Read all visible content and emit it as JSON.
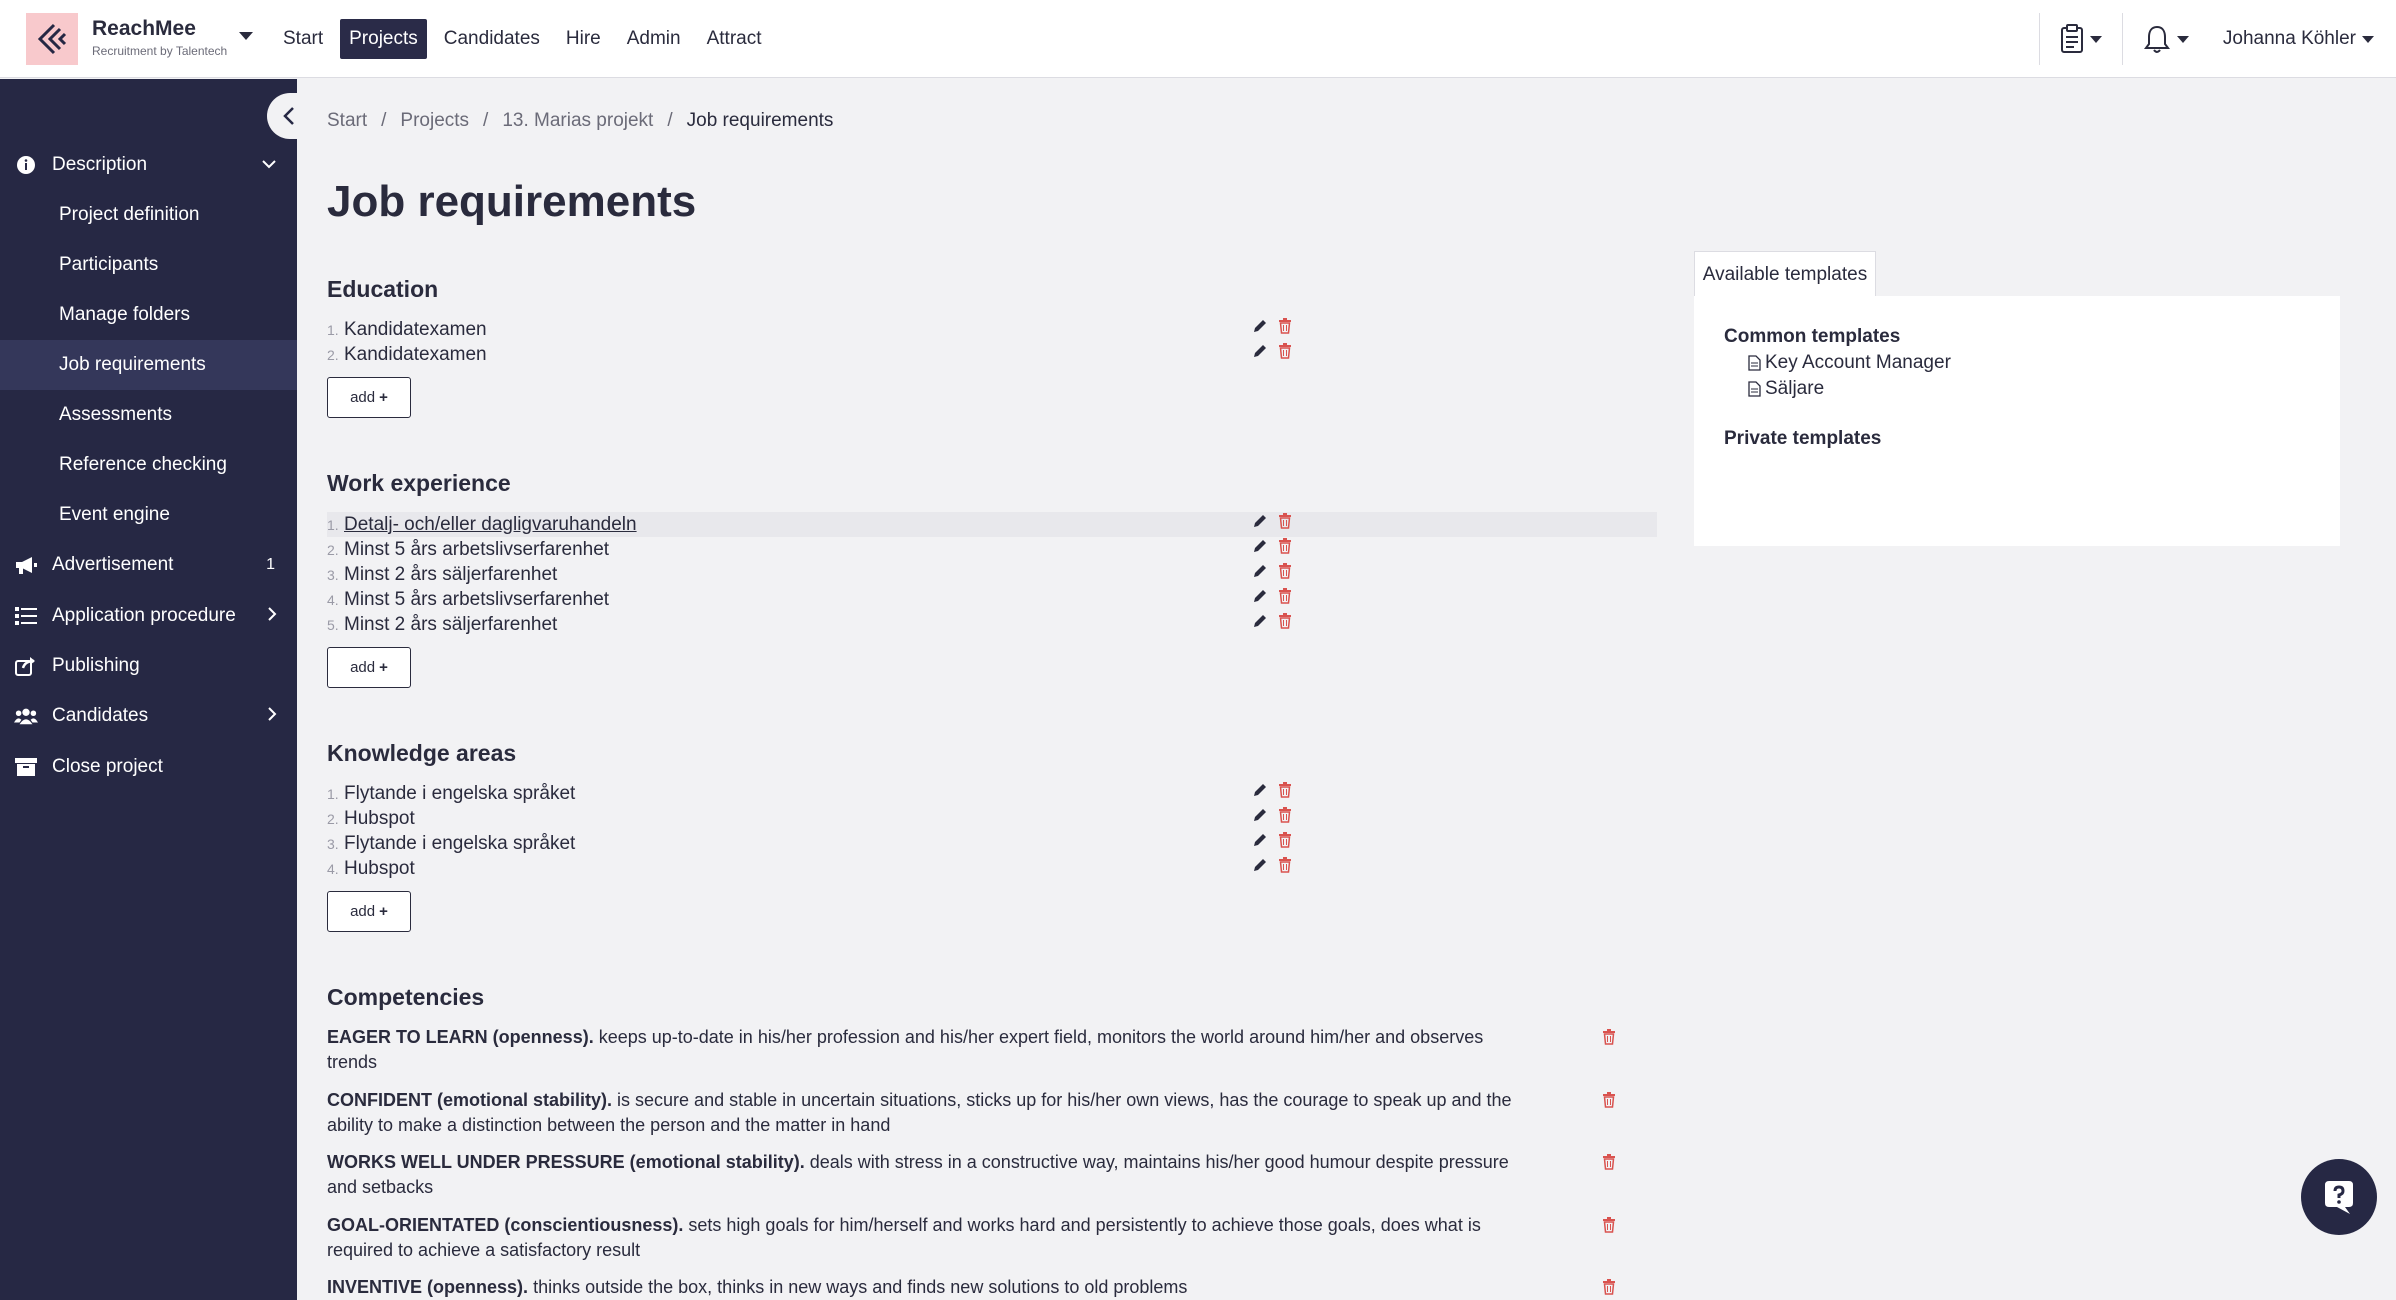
{
  "brand": {
    "name": "ReachMee",
    "subtitle": "Recruitment by Talentech"
  },
  "topnav": [
    "Start",
    "Projects",
    "Candidates",
    "Hire",
    "Admin",
    "Attract"
  ],
  "user": {
    "name": "Johanna Köhler"
  },
  "sidebar": {
    "description": "Description",
    "sub": [
      "Project definition",
      "Participants",
      "Manage folders",
      "Job requirements",
      "Assessments",
      "Reference checking",
      "Event engine"
    ],
    "advertisement": "Advertisement",
    "advertisement_count": "1",
    "application_procedure": "Application procedure",
    "publishing": "Publishing",
    "candidates": "Candidates",
    "close_project": "Close project"
  },
  "breadcrumb": [
    "Start",
    "Projects",
    "13. Marias projekt",
    "Job requirements"
  ],
  "page_title": "Job requirements",
  "add_label": "add",
  "education": {
    "title": "Education",
    "items": [
      "Kandidatexamen",
      "Kandidatexamen"
    ]
  },
  "work": {
    "title": "Work experience",
    "items": [
      "Detalj- och/eller dagligvaruhandeln",
      "Minst 5 års arbetslivserfarenhet",
      "Minst 2 års säljerfarenhet",
      "Minst 5 års arbetslivserfarenhet",
      "Minst 2 års säljerfarenhet"
    ]
  },
  "knowledge": {
    "title": "Knowledge areas",
    "items": [
      "Flytande i engelska språket",
      "Hubspot",
      "Flytande i engelska språket",
      "Hubspot"
    ]
  },
  "competencies": {
    "title": "Competencies",
    "items": [
      {
        "name": "EAGER TO LEARN (openness).",
        "desc": "keeps up-to-date in his/her profession and his/her expert field, monitors the world around him/her and observes trends"
      },
      {
        "name": "CONFIDENT (emotional stability).",
        "desc": "is secure and stable in uncertain situations, sticks up for his/her own views, has the courage to speak up and the ability to make a distinction between the person and the matter in hand"
      },
      {
        "name": "WORKS WELL UNDER PRESSURE (emotional stability).",
        "desc": "deals with stress in a constructive way, maintains his/her good humour despite pressure and setbacks"
      },
      {
        "name": "GOAL-ORIENTATED (conscientiousness).",
        "desc": "sets high goals for him/herself and works hard and persistently to achieve those goals, does what is required to achieve a satisfactory result"
      },
      {
        "name": "INVENTIVE (openness).",
        "desc": "thinks outside the box, thinks in new ways and finds new solutions to old problems"
      }
    ]
  },
  "templates": {
    "tab": "Available templates",
    "common_title": "Common templates",
    "common": [
      "Key Account Manager",
      "Säljare"
    ],
    "private_title": "Private templates"
  }
}
